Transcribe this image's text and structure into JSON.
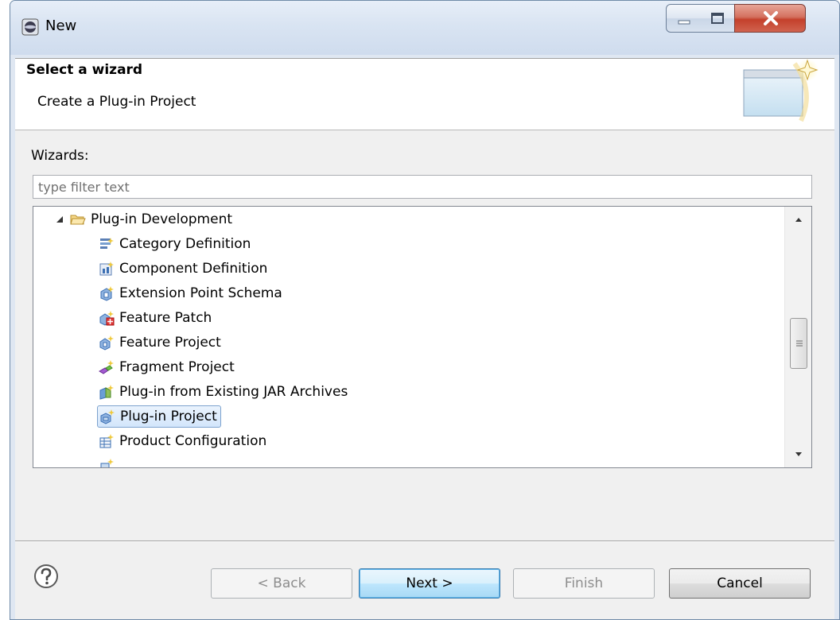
{
  "window": {
    "title": "New",
    "minimize_icon": "minimize-icon",
    "maximize_icon": "maximize-icon",
    "close_icon": "close-icon"
  },
  "header": {
    "title": "Select a wizard",
    "description": "Create a Plug-in Project",
    "banner_icon": "new-wizard-banner-icon"
  },
  "wizards": {
    "label": "Wizards:",
    "filter_placeholder": "type filter text",
    "filter_value": "",
    "tree": {
      "category": {
        "label": "Plug-in Development",
        "expanded": true,
        "icon": "folder-open-icon"
      },
      "items": [
        {
          "label": "Category Definition",
          "icon": "category-definition-icon",
          "selected": false
        },
        {
          "label": "Component Definition",
          "icon": "component-definition-icon",
          "selected": false
        },
        {
          "label": "Extension Point Schema",
          "icon": "extension-point-schema-icon",
          "selected": false
        },
        {
          "label": "Feature Patch",
          "icon": "feature-patch-icon",
          "selected": false
        },
        {
          "label": "Feature Project",
          "icon": "feature-project-icon",
          "selected": false
        },
        {
          "label": "Fragment Project",
          "icon": "fragment-project-icon",
          "selected": false
        },
        {
          "label": "Plug-in from Existing JAR Archives",
          "icon": "plugin-from-jar-icon",
          "selected": false
        },
        {
          "label": "Plug-in Project",
          "icon": "plugin-project-icon",
          "selected": true
        },
        {
          "label": "Product Configuration",
          "icon": "product-configuration-icon",
          "selected": false
        }
      ]
    }
  },
  "footer": {
    "help_icon": "help-icon",
    "back_label": "< Back",
    "next_label": "Next >",
    "finish_label": "Finish",
    "cancel_label": "Cancel"
  },
  "colors": {
    "selection_bg": "#d3e6fb",
    "selection_border": "#7da2ce",
    "default_button": "#bee6fd",
    "close_button": "#c4402b"
  }
}
